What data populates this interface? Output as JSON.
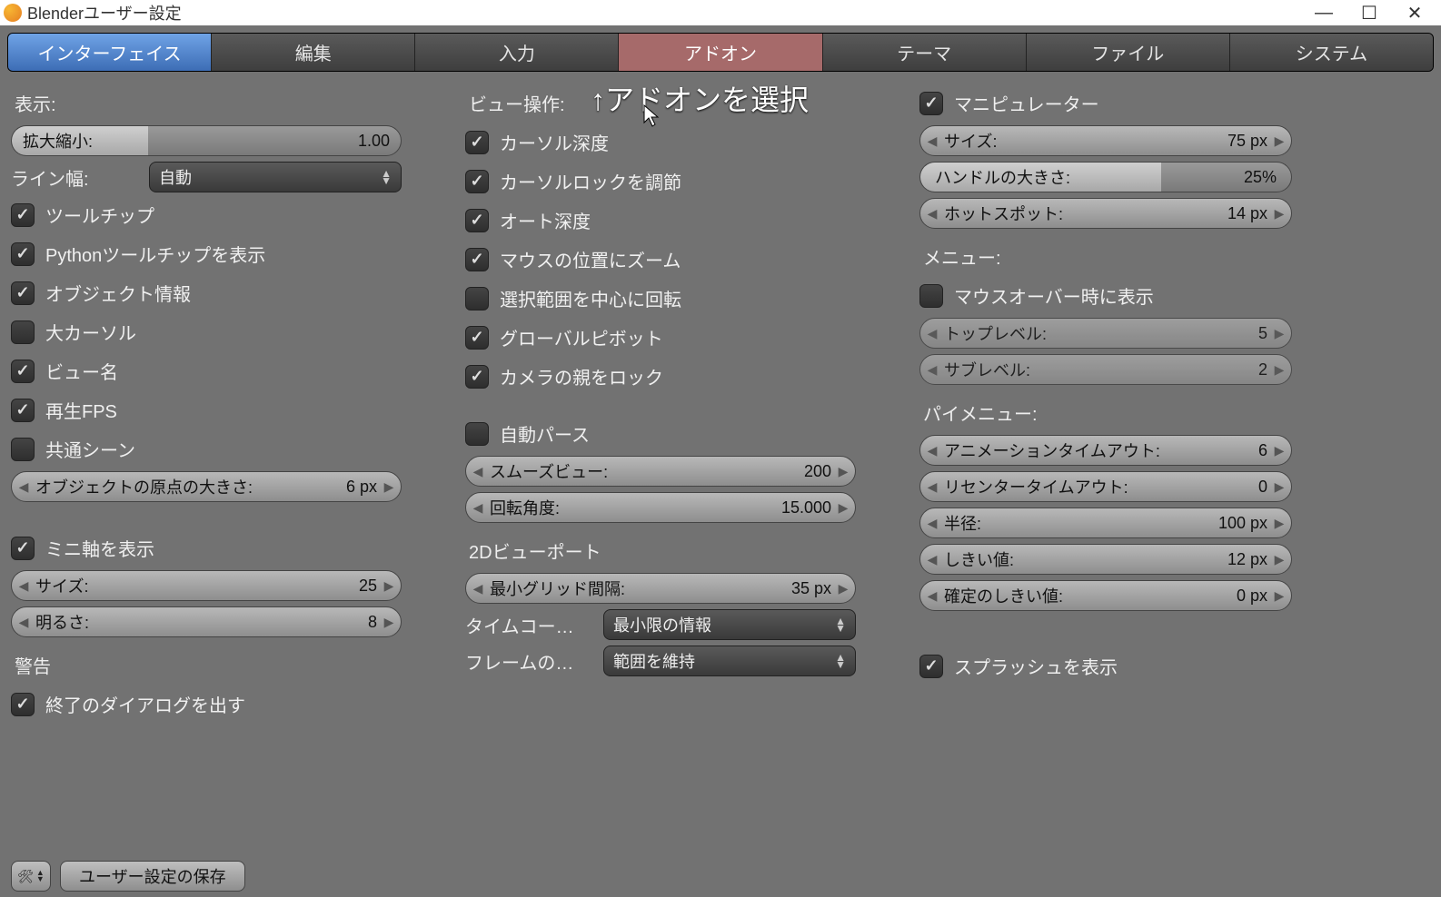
{
  "window": {
    "title": "Blenderユーザー設定",
    "min": "—",
    "max": "☐",
    "close": "✕"
  },
  "tabs": [
    "インターフェイス",
    "編集",
    "入力",
    "アドオン",
    "テーマ",
    "ファイル",
    "システム"
  ],
  "annotation": "↑アドオンを選択",
  "col1": {
    "display_label": "表示:",
    "zoom_label": "拡大縮小:",
    "zoom_value": "1.00",
    "linewidth_label": "ライン幅:",
    "linewidth_value": "自動",
    "chk_tooltip": "ツールチップ",
    "chk_python": "Pythonツールチップを表示",
    "chk_objinfo": "オブジェクト情報",
    "chk_bigcursor": "大カーソル",
    "chk_viewname": "ビュー名",
    "chk_playfps": "再生FPS",
    "chk_globalscene": "共通シーン",
    "origin_label": "オブジェクトの原点の大きさ:",
    "origin_value": "6 px",
    "miniaxis": "ミニ軸を表示",
    "size_label": "サイズ:",
    "size_value": "25",
    "bright_label": "明るさ:",
    "bright_value": "8",
    "warn_label": "警告",
    "quit_dialog": "終了のダイアログを出す"
  },
  "col2": {
    "viewmanip_label": "ビュー操作:",
    "cursor_depth": "カーソル深度",
    "cursor_lock": "カーソルロックを調節",
    "auto_depth": "オート深度",
    "zoom_mouse": "マウスの位置にズーム",
    "rotate_sel": "選択範囲を中心に回転",
    "global_pivot": "グローバルピボット",
    "camera_parent": "カメラの親をロック",
    "auto_persp": "自動パース",
    "smoothview_label": "スムーズビュー:",
    "smoothview_value": "200",
    "rotangle_label": "回転角度:",
    "rotangle_value": "15.000",
    "viewport2d_label": "2Dビューポート",
    "mingrid_label": "最小グリッド間隔:",
    "mingrid_value": "35 px",
    "timecode_label": "タイムコー…",
    "timecode_value": "最小限の情報",
    "frame_label": "フレームの…",
    "frame_value": "範囲を維持"
  },
  "col3": {
    "manipulator": "マニピュレーター",
    "size_label": "サイズ:",
    "size_value": "75 px",
    "handle_label": "ハンドルの大きさ:",
    "handle_value": "25%",
    "hotspot_label": "ホットスポット:",
    "hotspot_value": "14 px",
    "menu_label": "メニュー:",
    "mouseover": "マウスオーバー時に表示",
    "toplevel_label": "トップレベル:",
    "toplevel_value": "5",
    "sublevel_label": "サブレベル:",
    "sublevel_value": "2",
    "piemenu_label": "パイメニュー:",
    "anim_label": "アニメーションタイムアウト:",
    "anim_value": "6",
    "recenter_label": "リセンタータイムアウト:",
    "recenter_value": "0",
    "radius_label": "半径:",
    "radius_value": "100 px",
    "thresh_label": "しきい値:",
    "thresh_value": "12 px",
    "confirm_label": "確定のしきい値:",
    "confirm_value": "0 px",
    "splash": "スプラッシュを表示"
  },
  "bottom": {
    "save": "ユーザー設定の保存"
  }
}
